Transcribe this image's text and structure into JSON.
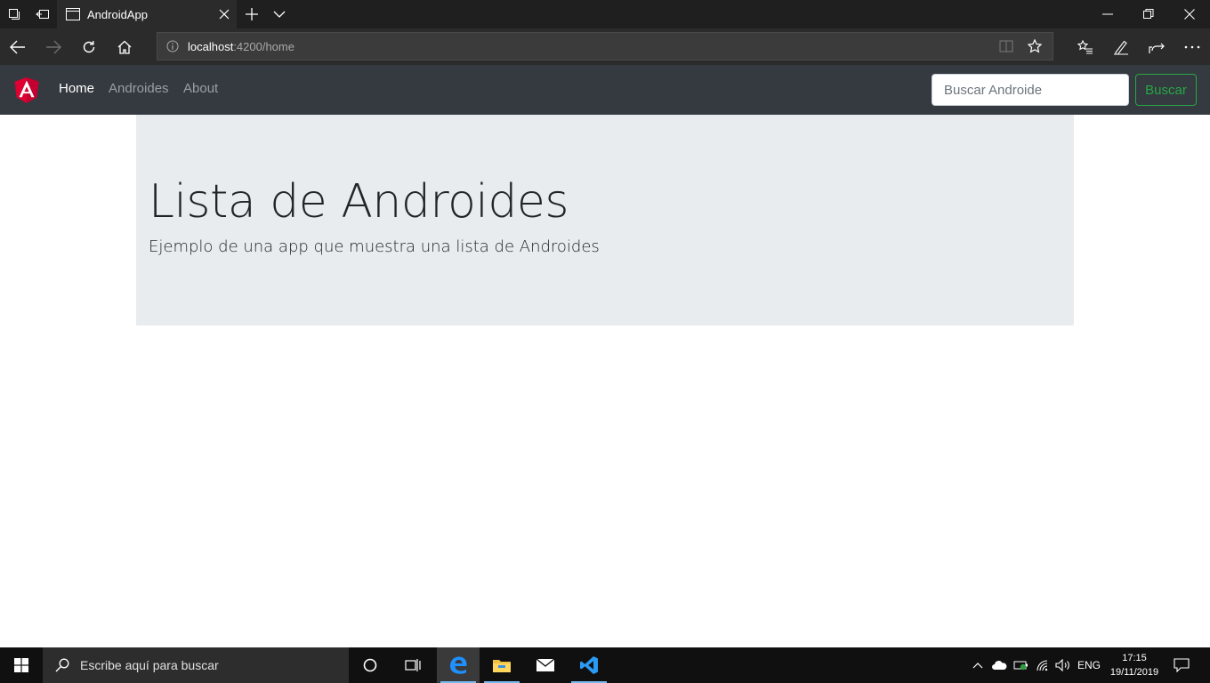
{
  "browser": {
    "tab_title": "AndroidApp",
    "url_host": "localhost",
    "url_rest": ":4200/home"
  },
  "navbar": {
    "links": [
      {
        "label": "Home",
        "active": true
      },
      {
        "label": "Androides",
        "active": false
      },
      {
        "label": "About",
        "active": false
      }
    ],
    "search_placeholder": "Buscar Androide",
    "search_button": "Buscar",
    "colors": {
      "navbar_bg": "#343a40",
      "success": "#28a745",
      "brand_red": "#dd0031"
    }
  },
  "jumbotron": {
    "title": "Lista de Androides",
    "lead": "Ejemplo de una app que muestra una lista de Androides"
  },
  "taskbar": {
    "search_placeholder": "Escribe aquí para buscar",
    "language": "ENG",
    "time": "17:15",
    "date": "19/11/2019"
  }
}
